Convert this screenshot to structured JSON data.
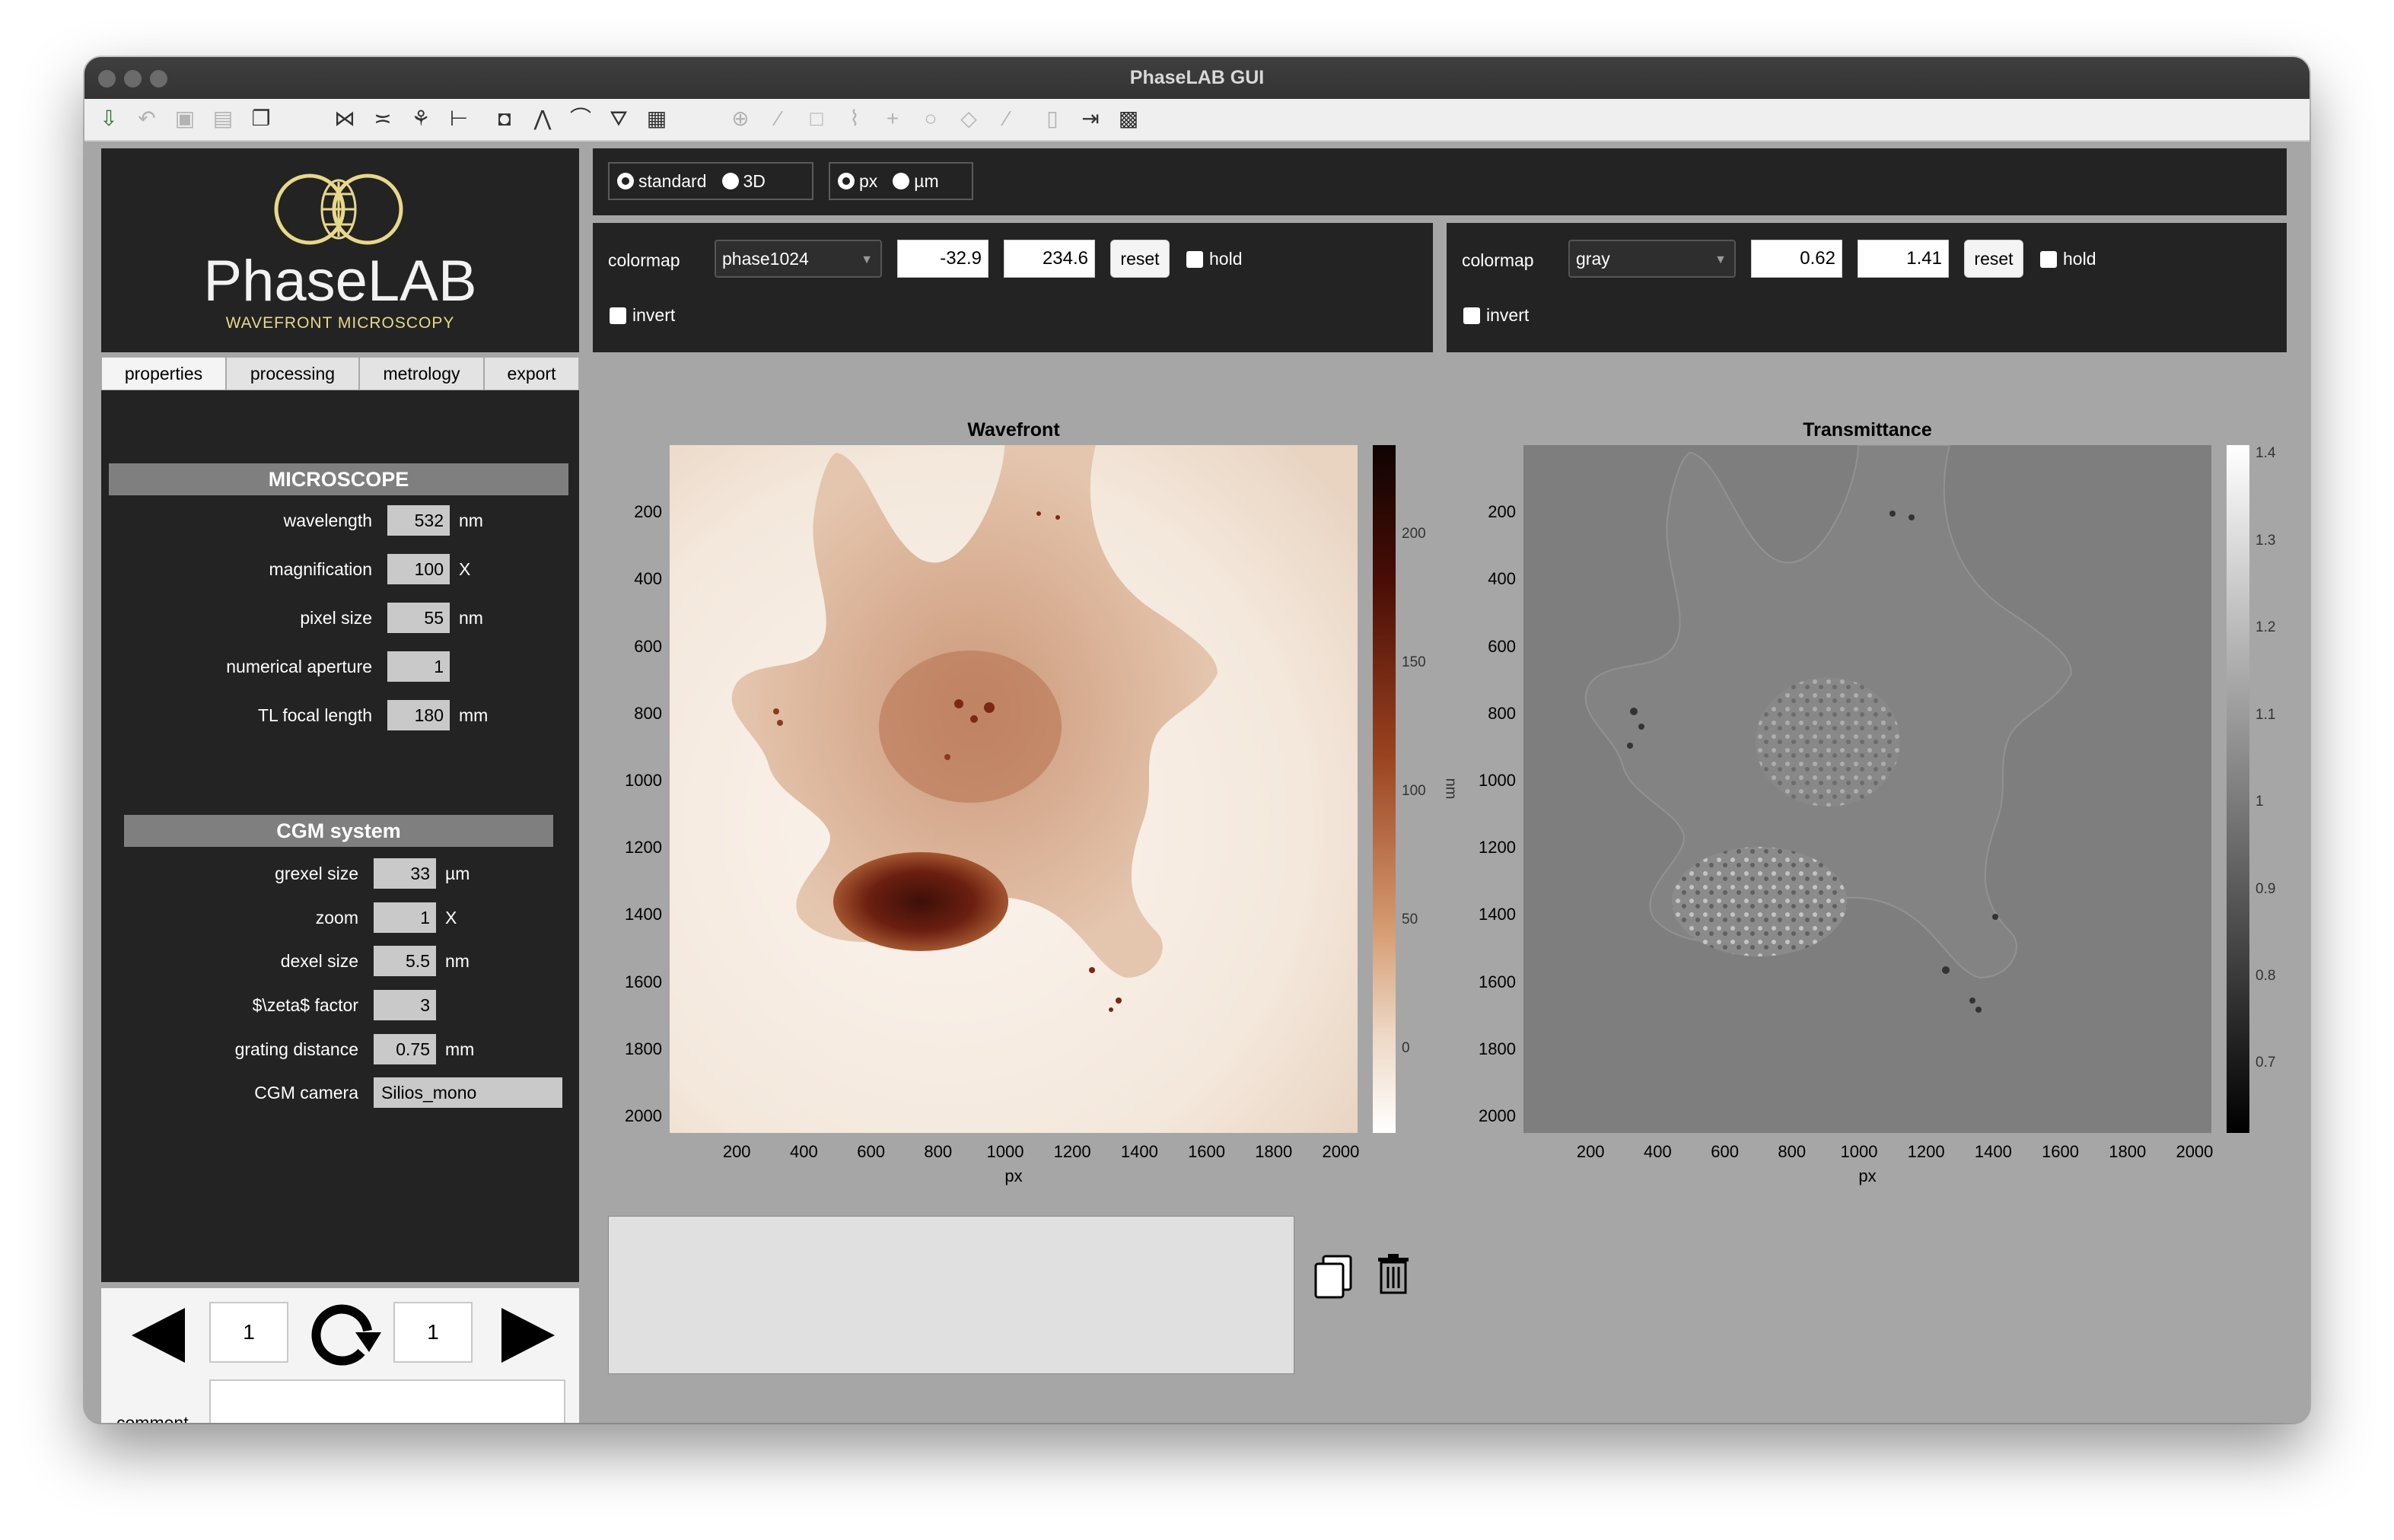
{
  "window": {
    "title": "PhaseLAB GUI"
  },
  "toolbar": {
    "icons": [
      "import-icon",
      "undo-icon",
      "save-icon",
      "save-all-icon",
      "copy-icon",
      "crop-icon",
      "flip-icon",
      "analyze-icon",
      "axis-icon",
      "frame-icon",
      "peak-icon",
      "curve-icon",
      "filter-icon",
      "grid-icon",
      "crosshair-icon",
      "line-icon",
      "rectangle-icon",
      "polyline-icon",
      "plus-icon",
      "circle-icon",
      "polygon-icon",
      "wand-icon",
      "document-icon",
      "export-icon",
      "film-icon"
    ]
  },
  "logo": {
    "name": "PhaseLAB",
    "tagline": "WAVEFRONT MICROSCOPY"
  },
  "tabs": [
    "properties",
    "processing",
    "metrology",
    "export"
  ],
  "microscope": {
    "header": "MICROSCOPE",
    "fields": [
      {
        "label": "wavelength",
        "value": "532",
        "unit": "nm"
      },
      {
        "label": "magnification",
        "value": "100",
        "unit": "X"
      },
      {
        "label": "pixel size",
        "value": "55",
        "unit": "nm"
      },
      {
        "label": "numerical aperture",
        "value": "1",
        "unit": ""
      },
      {
        "label": "TL focal length",
        "value": "180",
        "unit": "mm"
      }
    ]
  },
  "cgm": {
    "header": "CGM system",
    "fields": [
      {
        "label": "grexel size",
        "value": "33",
        "unit": "µm"
      },
      {
        "label": "zoom",
        "value": "1",
        "unit": "X"
      },
      {
        "label": "dexel size",
        "value": "5.5",
        "unit": "nm"
      },
      {
        "label": "$\\zeta$ factor",
        "value": "3",
        "unit": ""
      },
      {
        "label": "grating distance",
        "value": "0.75",
        "unit": "mm"
      }
    ],
    "camera_label": "CGM camera",
    "camera_value": "Silios_mono"
  },
  "nav": {
    "left_index": "1",
    "right_index": "1",
    "comment_label": "comment",
    "comment_value": ""
  },
  "view_mode": {
    "options": [
      "standard",
      "3D"
    ],
    "selected": "standard"
  },
  "units_mode": {
    "options": [
      "px",
      "µm"
    ],
    "selected": "px"
  },
  "left_colormap": {
    "label": "colormap",
    "name": "phase1024",
    "min": "-32.9",
    "max": "234.6",
    "reset": "reset",
    "hold": "hold",
    "invert": "invert"
  },
  "right_colormap": {
    "label": "colormap",
    "name": "gray",
    "min": "0.62",
    "max": "1.41",
    "reset": "reset",
    "hold": "hold",
    "invert": "invert"
  },
  "wavefront_plot": {
    "title": "Wavefront",
    "y_ticks": [
      "200",
      "400",
      "600",
      "800",
      "1000",
      "1200",
      "1400",
      "1600",
      "1800",
      "2000"
    ],
    "x_ticks": [
      "200",
      "400",
      "600",
      "800",
      "1000",
      "1200",
      "1400",
      "1600",
      "1800",
      "2000"
    ],
    "xlabel": "px",
    "colorbar_ticks": [
      "200",
      "150",
      "100",
      "50",
      "0"
    ],
    "colorbar_label": "nm"
  },
  "transmittance_plot": {
    "title": "Transmittance",
    "y_ticks": [
      "200",
      "400",
      "600",
      "800",
      "1000",
      "1200",
      "1400",
      "1600",
      "1800",
      "2000"
    ],
    "x_ticks": [
      "200",
      "400",
      "600",
      "800",
      "1000",
      "1200",
      "1400",
      "1600",
      "1800",
      "2000"
    ],
    "xlabel": "px",
    "colorbar_ticks": [
      "1.4",
      "1.3",
      "1.2",
      "1.1",
      "1",
      "0.9",
      "0.8",
      "0.7"
    ]
  },
  "colors": {
    "window_bg": "#a6a6a6",
    "panel_dark": "#232323",
    "logo_gold": "#e8d88a",
    "wavefront_dark": "#3b0f08",
    "wavefront_light": "#f6ece4"
  }
}
